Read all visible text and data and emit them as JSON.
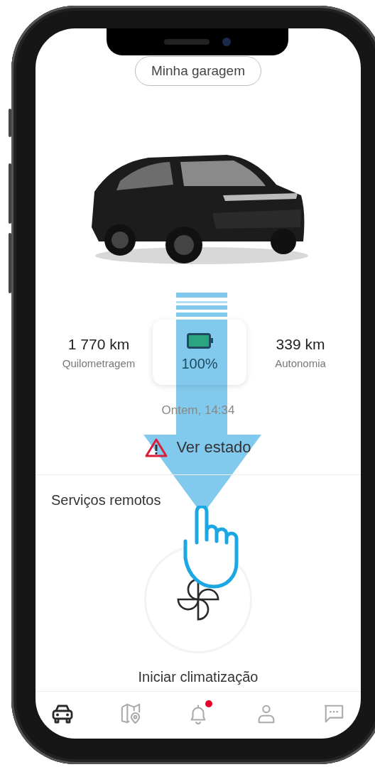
{
  "garage_button": {
    "label": "Minha garagem"
  },
  "stats": {
    "mileage": {
      "value": "1 770 km",
      "label": "Quilometragem"
    },
    "battery": {
      "level": 1,
      "reading": "100%"
    },
    "range": {
      "value": "339 km",
      "label": "Autonomia"
    }
  },
  "updated": "Ontem, 14:34",
  "status_link": {
    "label": "Ver estado"
  },
  "remote_services": {
    "title": "Serviços remotos",
    "action": "Iniciar climatização"
  },
  "bottom_nav": [
    {
      "kind": "car",
      "selected": true,
      "badge": false
    },
    {
      "kind": "map",
      "selected": false,
      "badge": false
    },
    {
      "kind": "bell",
      "selected": false,
      "badge": true
    },
    {
      "kind": "person",
      "selected": false,
      "badge": false
    },
    {
      "kind": "chat",
      "selected": false,
      "badge": false
    }
  ]
}
